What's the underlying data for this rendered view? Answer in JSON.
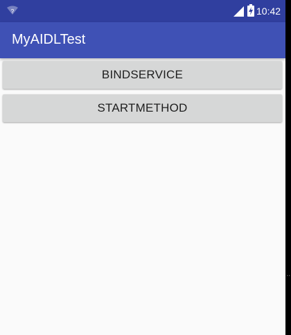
{
  "status_bar": {
    "time": "10:42",
    "icons": [
      "wifi-icon",
      "signal-icon",
      "battery-charging-icon"
    ]
  },
  "app_bar": {
    "title": "MyAIDLTest"
  },
  "buttons": {
    "bind_service": "BINDSERVICE",
    "start_method": "STARTMETHOD"
  },
  "colors": {
    "status_bar": "#303f9f",
    "app_bar": "#3f51b5",
    "background": "#fafafa",
    "button": "#d6d7d7"
  }
}
